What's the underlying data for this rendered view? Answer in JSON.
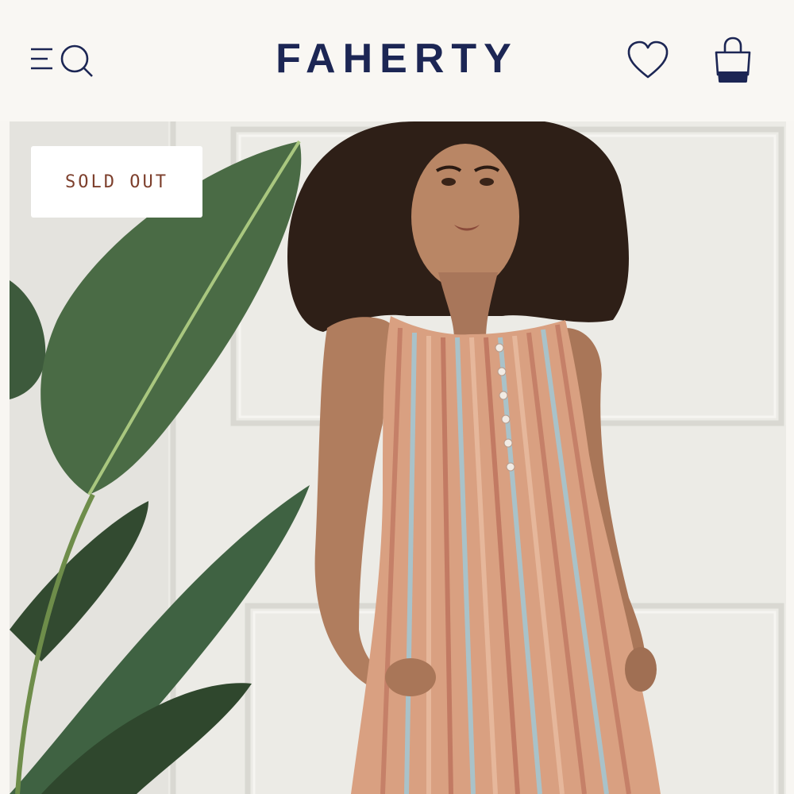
{
  "header": {
    "brand": "FAHERTY",
    "icons": {
      "menu": "hamburger-menu-icon",
      "search": "search-icon",
      "wishlist": "heart-icon",
      "cart": "shopping-bag-icon"
    },
    "brand_color": "#1c2654"
  },
  "product": {
    "badge": "SOLD OUT",
    "badge_color": "#7d3f2c"
  }
}
